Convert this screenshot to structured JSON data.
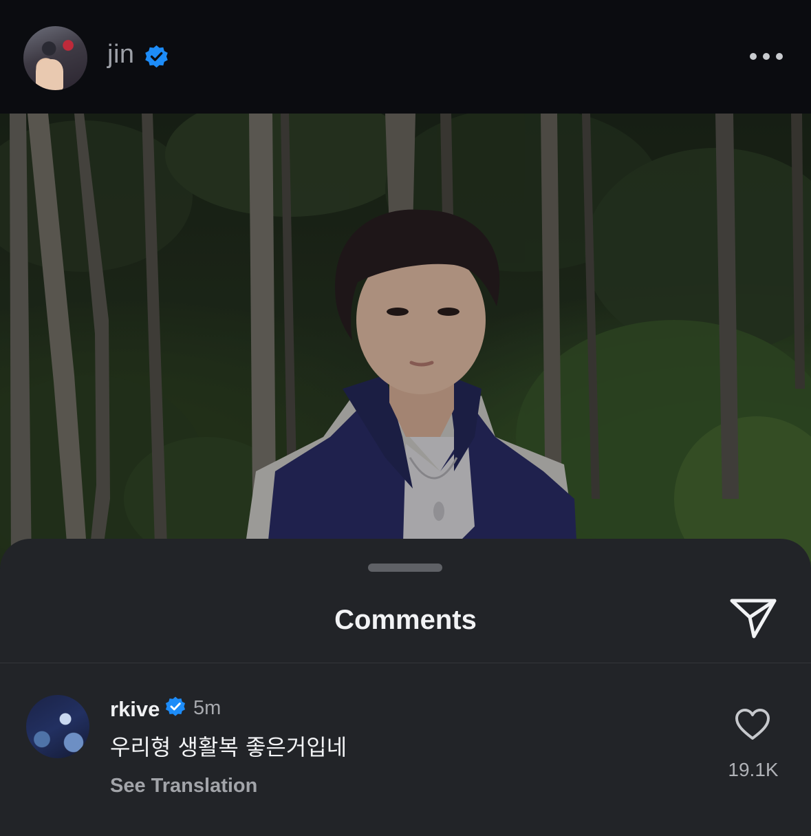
{
  "post": {
    "username": "jin",
    "verified": true,
    "avatar_icon": "profile-photo",
    "more_icon": "more-horizontal-icon"
  },
  "comments_sheet": {
    "title": "Comments",
    "send_icon": "paper-plane-icon",
    "comments": [
      {
        "username": "rkive",
        "verified": true,
        "time": "5m",
        "text": "우리형 생활복 좋은거입네",
        "translate_label": "See Translation",
        "likes": "19.1K",
        "like_icon": "heart-outline-icon"
      }
    ]
  },
  "colors": {
    "verified_badge": "#1d8cf8",
    "sheet_background": "#222428",
    "header_background": "#0b0c10"
  }
}
